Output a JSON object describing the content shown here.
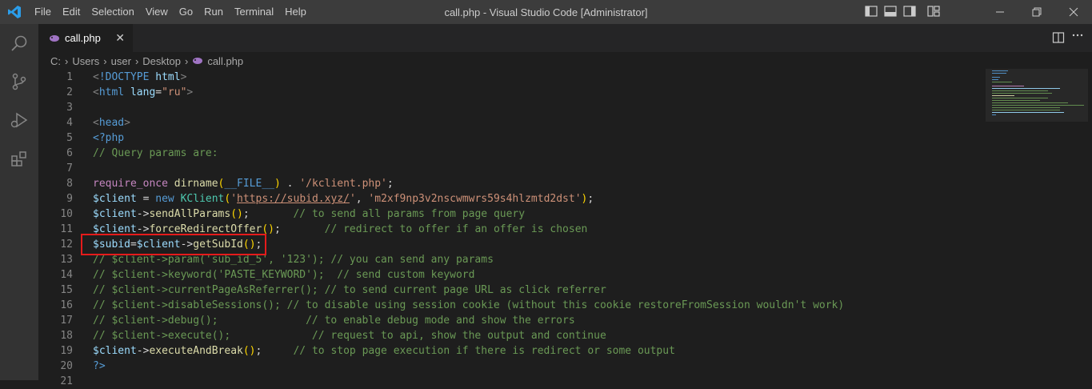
{
  "window": {
    "title": "call.php - Visual Studio Code [Administrator]"
  },
  "menu": [
    "File",
    "Edit",
    "Selection",
    "View",
    "Go",
    "Run",
    "Terminal",
    "Help"
  ],
  "tab": {
    "label": "call.php",
    "close_glyph": "✕"
  },
  "breadcrumb": [
    "C:",
    "Users",
    "user",
    "Desktop",
    "call.php"
  ],
  "editor": {
    "line_numbers": [
      "1",
      "2",
      "3",
      "4",
      "5",
      "6",
      "7",
      "8",
      "9",
      "10",
      "11",
      "12",
      "13",
      "14",
      "15",
      "16",
      "17",
      "18",
      "19",
      "20",
      "21"
    ],
    "highlighted_line": 12
  },
  "colors": {
    "accent": "#007acc",
    "highlight_box": "#e51b1b"
  },
  "icons": {
    "activity": [
      "search-icon",
      "source-control-icon",
      "run-debug-icon",
      "extensions-icon"
    ],
    "layout": [
      "toggle-sidebar-icon",
      "toggle-panel-icon",
      "toggle-secondary-sidebar-icon",
      "customize-layout-icon"
    ],
    "window": [
      "minimize-icon",
      "restore-icon",
      "close-icon"
    ]
  }
}
